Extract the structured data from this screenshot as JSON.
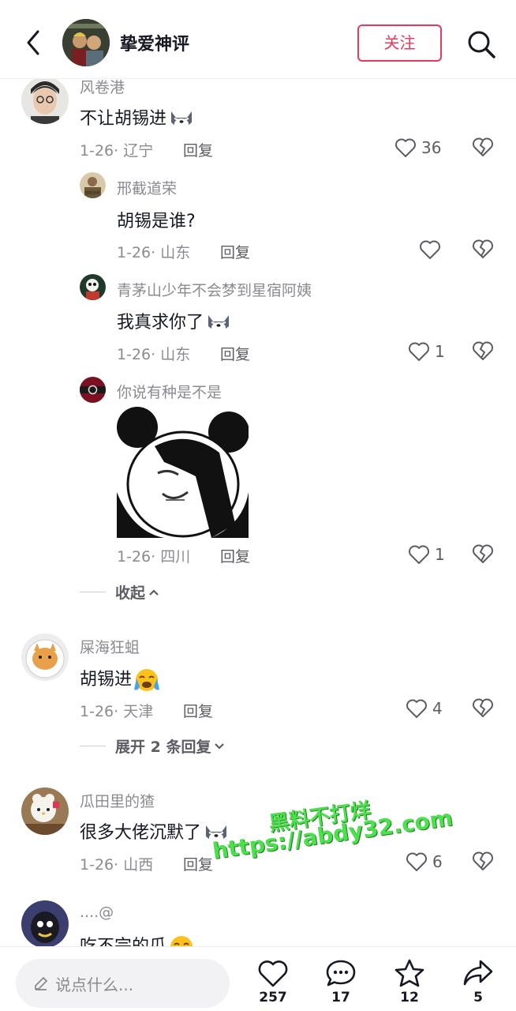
{
  "header": {
    "title": "挚爱神评",
    "follow_label": "关注"
  },
  "comments": [
    {
      "user": "风卷港",
      "text": "不让胡锡进",
      "meta": "1-26· 辽宁",
      "reply_label": "回复",
      "likes": "36",
      "replies": [
        {
          "user": "邢截道荣",
          "text": "胡锡是谁?",
          "meta": "1-26· 山东",
          "reply_label": "回复",
          "likes": ""
        },
        {
          "user": "青茅山少年不会梦到星宿阿姨",
          "text": "我真求你了",
          "meta": "1-26· 山东",
          "reply_label": "回复",
          "likes": "1"
        },
        {
          "user": "你说有种是不是",
          "text": "",
          "meta": "1-26· 四川",
          "reply_label": "回复",
          "likes": "1"
        }
      ],
      "collapse_label": "收起"
    },
    {
      "user": "屎海狂蛆",
      "text": "胡锡进",
      "meta": "1-26· 天津",
      "reply_label": "回复",
      "likes": "4",
      "expand_label": "展开 2 条回复"
    },
    {
      "user": "瓜田里的猹",
      "text": "很多大佬沉默了",
      "meta": "1-26· 山西",
      "reply_label": "回复",
      "likes": "6"
    },
    {
      "user": "....@",
      "text": "吃不完的瓜"
    }
  ],
  "watermark": {
    "line1": "黑料不打烊",
    "line2": "https://abdy32.com"
  },
  "bottom_bar": {
    "input_placeholder": "说点什么...",
    "likes": "257",
    "comments": "17",
    "favorites": "12",
    "shares": "5"
  },
  "colors": {
    "accent": "#e8395c",
    "muted": "#8a8b91",
    "text": "#161823"
  }
}
